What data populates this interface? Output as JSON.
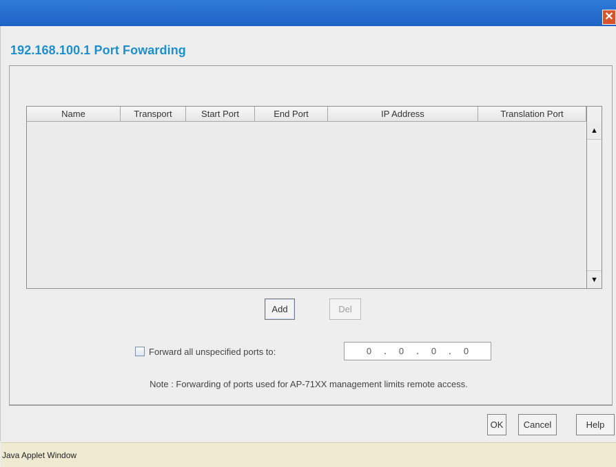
{
  "window": {
    "title": "192.168.100.1 Port Fowarding",
    "close_icon": "close-icon",
    "close_glyph": "✕"
  },
  "table": {
    "columns": [
      "Name",
      "Transport",
      "Start Port",
      "End Port",
      "IP Address",
      "Translation Port"
    ]
  },
  "scrollbar": {
    "up_glyph": "▲",
    "down_glyph": "▼"
  },
  "buttons": {
    "add_label": "Add",
    "del_label": "Del",
    "ok_label": "OK",
    "cancel_label": "Cancel",
    "help_label": "Help"
  },
  "forward": {
    "label": "Forward all unspecified ports to:",
    "ip_octets": [
      "0",
      "0",
      "0",
      "0"
    ]
  },
  "note": "Note : Forwarding of ports used for AP-71XX management limits remote access.",
  "status": "Java Applet Window",
  "colors": {
    "title_text": "#1d8fcf",
    "titlebar": "#2f7bd8",
    "close_button": "#d9542b",
    "status_bar": "#efebd3"
  }
}
